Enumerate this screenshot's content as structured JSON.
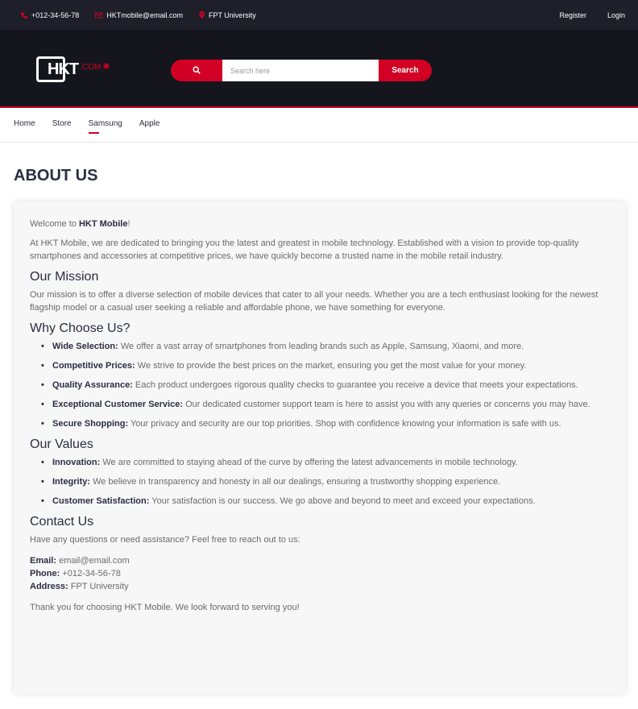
{
  "topbar": {
    "phone": "+012-34-56-78",
    "email": "HKTmobile@email.com",
    "location": "FPT University",
    "register": "Register",
    "login": "Login"
  },
  "header": {
    "logo_text": "HKT",
    "logo_suffix": ".COM",
    "search_placeholder": "Search here",
    "search_button": "Search"
  },
  "nav": {
    "items": [
      "Home",
      "Store",
      "Samsung",
      "Apple"
    ],
    "active": "Samsung"
  },
  "about": {
    "title": "ABOUT US",
    "welcome_prefix": "Welcome to ",
    "welcome_brand": "HKT Mobile",
    "welcome_suffix": "!",
    "intro": "At HKT Mobile, we are dedicated to bringing you the latest and greatest in mobile technology. Established with a vision to provide top-quality smartphones and accessories at competitive prices, we have quickly become a trusted name in the mobile retail industry.",
    "mission_title": "Our Mission",
    "mission_text": "Our mission is to offer a diverse selection of mobile devices that cater to all your needs. Whether you are a tech enthusiast looking for the newest flagship model or a casual user seeking a reliable and affordable phone, we have something for everyone.",
    "why_title": "Why Choose Us?",
    "why_items": [
      {
        "label": "Wide Selection:",
        "text": " We offer a vast array of smartphones from leading brands such as Apple, Samsung, Xiaomi, and more."
      },
      {
        "label": "Competitive Prices:",
        "text": " We strive to provide the best prices on the market, ensuring you get the most value for your money."
      },
      {
        "label": "Quality Assurance:",
        "text": " Each product undergoes rigorous quality checks to guarantee you receive a device that meets your expectations."
      },
      {
        "label": "Exceptional Customer Service:",
        "text": " Our dedicated customer support team is here to assist you with any queries or concerns you may have."
      },
      {
        "label": "Secure Shopping:",
        "text": " Your privacy and security are our top priorities. Shop with confidence knowing your information is safe with us."
      }
    ],
    "values_title": "Our Values",
    "values_items": [
      {
        "label": "Innovation:",
        "text": " We are committed to staying ahead of the curve by offering the latest advancements in mobile technology."
      },
      {
        "label": "Integrity:",
        "text": " We believe in transparency and honesty in all our dealings, ensuring a trustworthy shopping experience."
      },
      {
        "label": "Customer Satisfaction:",
        "text": " Your satisfaction is our success. We go above and beyond to meet and exceed your expectations."
      }
    ],
    "contact_title": "Contact Us",
    "contact_intro": "Have any questions or need assistance? Feel free to reach out to us:",
    "email_label": "Email:",
    "email_value": " email@email.com",
    "phone_label": "Phone:",
    "phone_value": " +012-34-56-78",
    "address_label": "Address:",
    "address_value": " FPT University",
    "closing": "Thank you for choosing HKT Mobile. We look forward to serving you!"
  },
  "colors": {
    "accent": "#d10024",
    "topbar_bg": "#1e1f29",
    "header_bg": "#15161d",
    "heading": "#2b2d42"
  }
}
